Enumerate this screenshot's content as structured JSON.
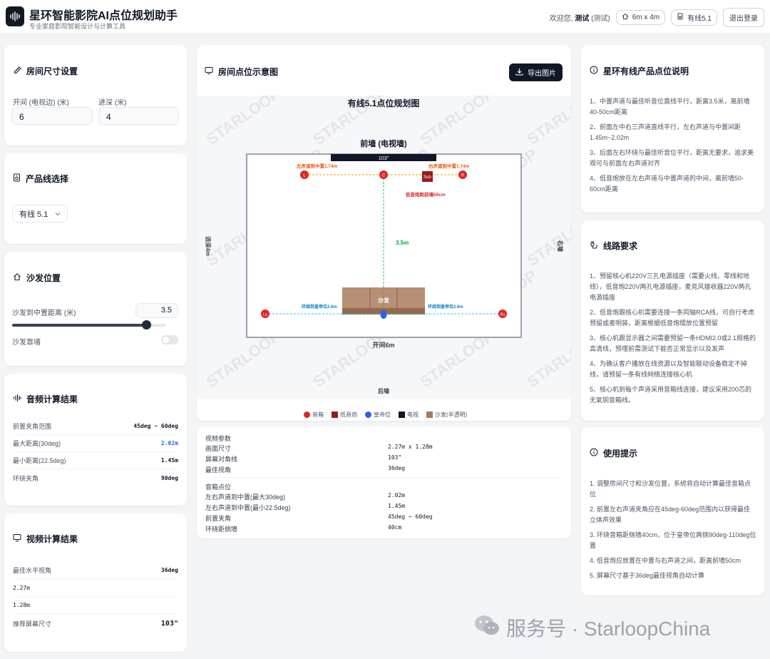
{
  "header": {
    "title": "星环智能影院AI点位规划助手",
    "subtitle": "专业家庭影院智能设计与计算工具",
    "welcome": "欢迎您,",
    "user": "测试",
    "user_tag": "(测试)",
    "room_chip": "6m x 4m",
    "product_chip": "有线5.1",
    "logout": "退出登录"
  },
  "room_size": {
    "title": "房间尺寸设置",
    "width_label": "开间 (电视边) (米)",
    "width_value": "6",
    "depth_label": "进深 (米)",
    "depth_value": "4"
  },
  "product": {
    "title": "产品线选择",
    "selected": "有线 5.1"
  },
  "sofa": {
    "title": "沙发位置",
    "distance_label": "沙发到中置距离 (米)",
    "distance_value": "3.5",
    "distance_fraction": 0.875,
    "wall_label": "沙发靠墙"
  },
  "audio_calc": {
    "title": "音频计算结果",
    "rows": [
      {
        "label": "前置夹角范围",
        "value": "45deg ~ 60deg",
        "accent": false
      },
      {
        "label": "最大距离(30deg)",
        "value": "2.02m",
        "accent": true
      },
      {
        "label": "最小距离(22.5deg)",
        "value": "1.45m",
        "accent": false
      },
      {
        "label": "环绕夹角",
        "value": "90deg",
        "accent": false
      }
    ]
  },
  "video_calc": {
    "title": "视频计算结果",
    "rows": [
      {
        "label": "最佳水平视角",
        "value": "36deg"
      },
      {
        "label": "2.27m",
        "value": ""
      },
      {
        "label": "1.28m",
        "value": ""
      },
      {
        "label": "推荐屏幕尺寸",
        "value": "103\""
      }
    ]
  },
  "diagram": {
    "card_title": "房间点位示意图",
    "export": "导出图片",
    "plan_title": "有线5.1点位规划图",
    "front_wall": "前墙 (电视墙)",
    "tv_size": "103\"",
    "left_to_center": "左声道到中置1.74m",
    "right_to_center": "右声道到中置1.74m",
    "sub_label": "低音炮距前墙50cm",
    "dist_label": "3.5m",
    "sofa": "沙发",
    "left_surround": "环绕到皇帝位2.6m",
    "right_surround": "环绕到皇帝位2.6m",
    "width_label": "开间6m",
    "depth_left": "进深4m",
    "right_wall": "右墙",
    "back_wall": "后墙",
    "watermark": "STARLOOP",
    "legend": [
      "音箱",
      "低音炮",
      "皇帝位",
      "电视",
      "沙发(半透明)"
    ],
    "speakers": {
      "L": "L",
      "C": "C",
      "R": "R",
      "Sub": "Sub",
      "Ls": "Ls",
      "Rs": "Rs"
    }
  },
  "params": {
    "video_head": "视频参数",
    "video": [
      {
        "k": "画面尺寸",
        "v": "2.27m x 1.28m"
      },
      {
        "k": "屏幕对角线",
        "v": "103\""
      },
      {
        "k": "最佳视角",
        "v": "36deg"
      }
    ],
    "audio_head": "音箱点位",
    "audio": [
      {
        "k": "左右声道到中置(最大30deg)",
        "v": "2.02m"
      },
      {
        "k": "左右声道到中置(最小22.5deg)",
        "v": "1.45m"
      },
      {
        "k": "前置夹角",
        "v": "45deg ~ 60deg"
      },
      {
        "k": "环绕距侧墙",
        "v": "40cm"
      }
    ]
  },
  "wired_info": {
    "title": "星环有线产品点位说明",
    "items": [
      "1、中置声道与最佳听音位直线平行，距离3.5米，离前墙40-50cm距离",
      "2、前面左中右三声道直线平行，左右声道与中置间距1.45m~2.02m",
      "3、后面左右环绕与最佳听音位平行，距离无要求，追求美观可与前面左右声道对齐",
      "4、低音炮放在左右声道与中置声道的中间，离前墙50-60cm距离"
    ]
  },
  "wiring": {
    "title": "线路要求",
    "items": [
      "1、预留核心机220V三孔电源插座（需要火线、零线和地线），低音炮220V两孔电源插座，麦克风接收器220V两孔电源插座",
      "2、低音炮跟核心机需要连接一条同轴RCA线，可自行考虑预留或者明装，距离根据低音炮摆放位置预留",
      "3、核心机跟显示器之间需要预留一条HDMI2.0或2.1规格的高清线，预埋前需测试下能否正常显示以及发声",
      "4、为确认客户播放在线资源以及智能联动设备稳定不掉线，请预留一条有线网络连接核心机",
      "5、核心机到每个声道采用音箱线连接，建议采用200芯的无氧铜音箱线。"
    ]
  },
  "tips": {
    "title": "使用提示",
    "items": [
      "1. 调整房间尺寸和沙发位置，系统将自动计算最佳音箱点位",
      "2. 前置左右声道夹角应在45deg-60deg范围内以获得最佳立体声效果",
      "3. 环绕音箱距侧墙40cm，位于皇帝位两侧90deg-110deg位置",
      "4. 低音炮应放置在中置与右声道之间，距离前墙50cm",
      "5. 屏幕尺寸基于36deg最佳视角自动计算"
    ]
  },
  "watermark": {
    "text": "服务号 · StarloopChina"
  },
  "colors": {
    "speaker": "#dc2626",
    "sub": "#991b1b",
    "seat": "#2563eb",
    "tv": "#111827",
    "sofa": "#a97b5c",
    "accent": "#2563eb"
  }
}
